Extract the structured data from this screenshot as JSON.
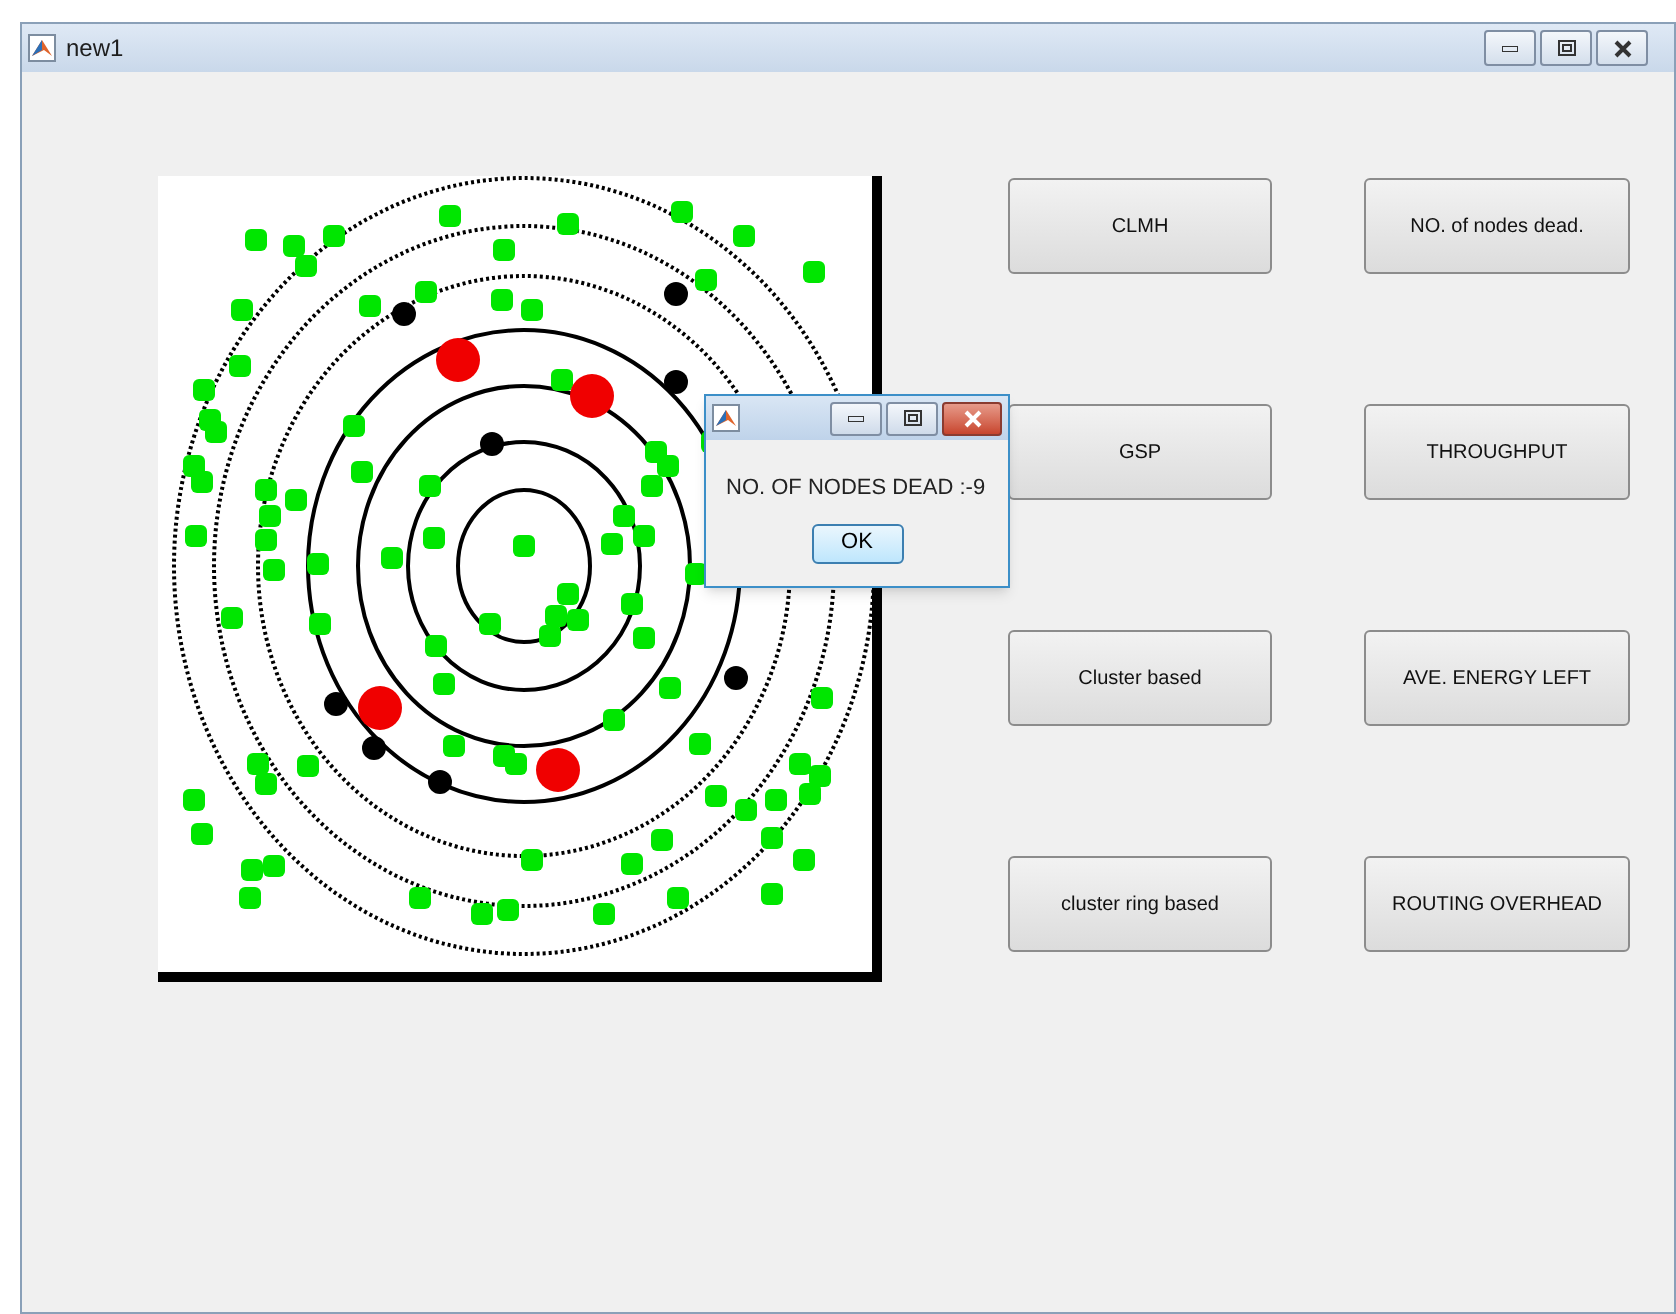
{
  "window": {
    "title": "new1"
  },
  "buttons": [
    {
      "label": "CLMH"
    },
    {
      "label": "NO. of nodes dead."
    },
    {
      "label": "GSP"
    },
    {
      "label": "THROUGHPUT"
    },
    {
      "label": "Cluster based"
    },
    {
      "label": "AVE. ENERGY LEFT"
    },
    {
      "label": "cluster ring based"
    },
    {
      "label": "ROUTING OVERHEAD"
    }
  ],
  "dialog": {
    "message": "NO. OF NODES DEAD :-9",
    "ok_label": "OK"
  }
}
